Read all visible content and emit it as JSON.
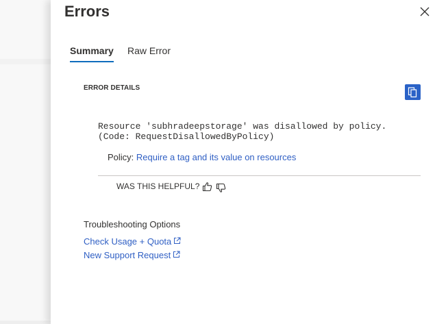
{
  "panel": {
    "title": "Errors",
    "close_icon": "close-icon"
  },
  "tabs": [
    {
      "label": "Summary",
      "active": true
    },
    {
      "label": "Raw Error",
      "active": false
    }
  ],
  "error_details": {
    "heading": "ERROR DETAILS",
    "copy_icon": "copy-icon",
    "message": "Resource 'subhradeepstorage' was disallowed by policy.\n(Code: RequestDisallowedByPolicy)",
    "policy_label": "Policy:",
    "policy_link": "Require a tag and its value on resources"
  },
  "feedback": {
    "question": "WAS THIS HELPFUL?",
    "thumb_up_icon": "thumbs-up-icon",
    "thumb_down_icon": "thumbs-down-icon"
  },
  "troubleshooting": {
    "heading": "Troubleshooting Options",
    "links": [
      {
        "label": "Check Usage + Quota",
        "icon": "external-link-icon"
      },
      {
        "label": "New Support Request",
        "icon": "external-link-icon"
      }
    ]
  },
  "colors": {
    "accent": "#0f6cbd",
    "link": "#2f5fc4",
    "copy_button": "#2a62c7",
    "text": "#323130"
  }
}
